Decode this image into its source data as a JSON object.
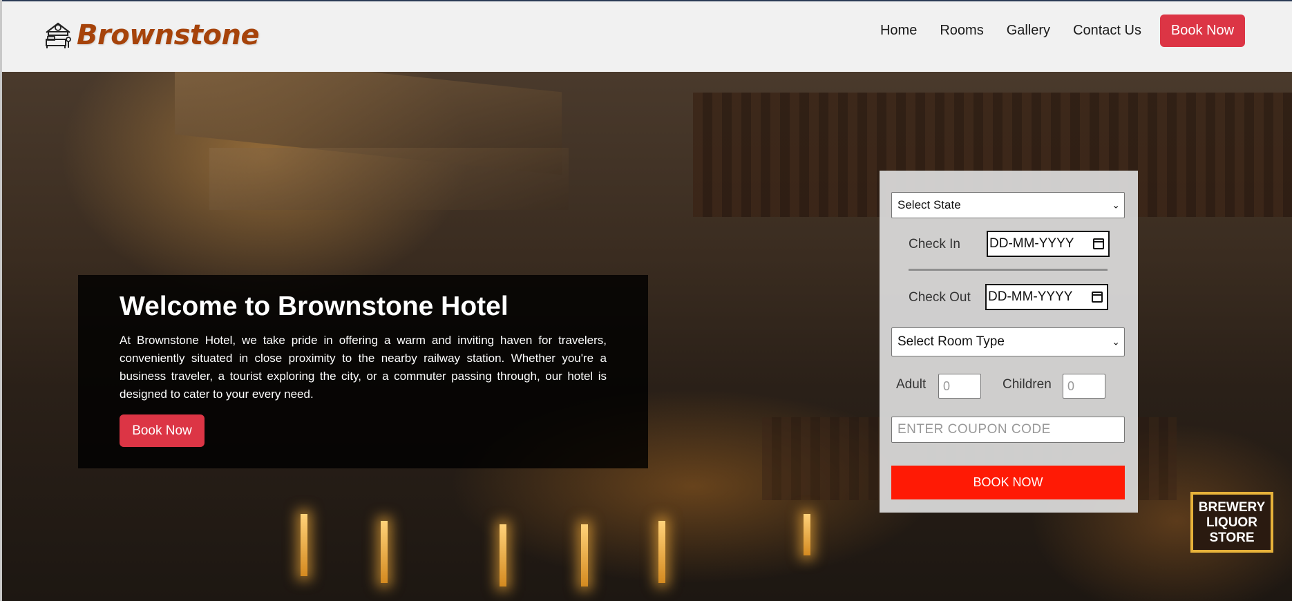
{
  "colors": {
    "brand": "#a6430a",
    "accent_red": "#dc3545",
    "cta_red": "#ff1a05",
    "header_bg": "#f1f1f1"
  },
  "header": {
    "logo_icon": "hotel-bed-icon",
    "brand_name": "Brownstone",
    "nav": [
      "Home",
      "Rooms",
      "Gallery",
      "Contact Us"
    ],
    "book_label": "Book Now"
  },
  "hero": {
    "title": "Welcome to Brownstone Hotel",
    "description": "At Brownstone Hotel, we take pride in offering a warm and inviting haven for travelers, conveniently situated in close proximity to the nearby railway station. Whether you're a business traveler, a tourist exploring the city, or a commuter passing through, our hotel is designed to cater to your every need.",
    "button_label": "Book Now",
    "background_sign_text": "BREWERY LIQUOR STORE"
  },
  "booking": {
    "state_select": "Select State",
    "check_in_label": "Check In",
    "check_in_value": "DD-MM-YYYY",
    "check_out_label": "Check Out",
    "check_out_value": "DD-MM-YYYY",
    "room_type_select": "Select Room Type",
    "adult_label": "Adult",
    "adult_placeholder": "0",
    "children_label": "Children",
    "children_placeholder": "0",
    "coupon_placeholder": "ENTER COUPON CODE",
    "submit_label": "BOOK NOW"
  }
}
